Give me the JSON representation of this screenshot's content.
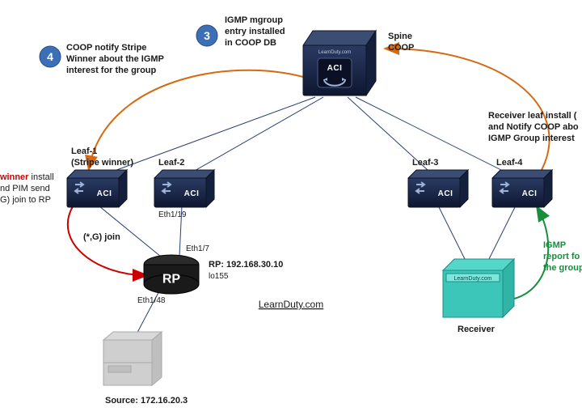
{
  "spine": {
    "name": "Spine",
    "sub": "COOP",
    "chip": "ACI",
    "brand": "LearnDuty.com"
  },
  "leaves": {
    "l1": {
      "name": "Leaf-1",
      "sub": "(Stripe winner)",
      "chip": "ACI"
    },
    "l2": {
      "name": "Leaf-2",
      "chip": "ACI",
      "port_down": "Eth1/19"
    },
    "l3": {
      "name": "Leaf-3",
      "chip": "ACI"
    },
    "l4": {
      "name": "Leaf-4",
      "chip": "ACI"
    }
  },
  "rp": {
    "label": "RP",
    "address": "RP: 192.168.30.10",
    "lo": "lo155",
    "port_up": "Eth1/7",
    "port_down": "Eth1/48"
  },
  "source": {
    "address": "Source: 172.16.20.3"
  },
  "receiver": {
    "label": "Receiver",
    "brand": "LearnDuty.com"
  },
  "join_label": "(*,G) join",
  "step3": {
    "num": "3",
    "l1": "IGMP mgroup",
    "l2": "entry installed",
    "l3": "in COOP DB"
  },
  "step4": {
    "num": "4",
    "l1": "COOP notify Stripe",
    "l2": "Winner about the IGMP",
    "l3": "interest for the group"
  },
  "right_note": {
    "l1": "Receiver leaf install (",
    "l2": "and Notify COOP abo",
    "l3": "IGMP Group interest"
  },
  "left_note": {
    "red": "winner",
    "black1": " install",
    "l2": "nd PIM send",
    "l3": "G) join to RP"
  },
  "igmp_note": {
    "l1": "IGMP",
    "l2": "report fo",
    "l3": "the group"
  },
  "footer": "LearnDuty.com"
}
